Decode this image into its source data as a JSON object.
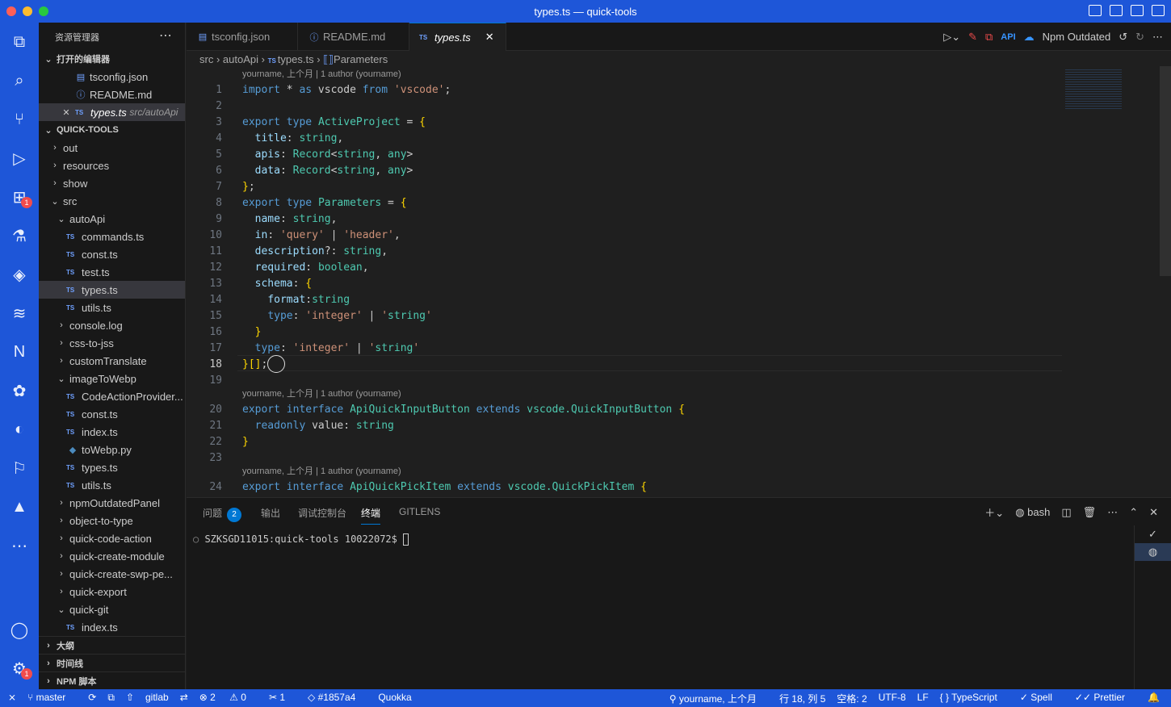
{
  "window": {
    "title": "types.ts — quick-tools"
  },
  "explorer": {
    "title": "资源管理器",
    "open_editors_label": "打开的编辑器",
    "open_editors": [
      {
        "name": "tsconfig.json"
      },
      {
        "name": "README.md"
      },
      {
        "name": "types.ts",
        "path": "src/autoApi"
      }
    ],
    "project_label": "QUICK-TOOLS",
    "tree": [
      {
        "name": "out",
        "kind": "folder",
        "depth": 1,
        "open": false
      },
      {
        "name": "resources",
        "kind": "folder",
        "depth": 1,
        "open": false
      },
      {
        "name": "show",
        "kind": "folder",
        "depth": 1,
        "open": false
      },
      {
        "name": "src",
        "kind": "folder",
        "depth": 1,
        "open": true
      },
      {
        "name": "autoApi",
        "kind": "folder",
        "depth": 2,
        "open": true
      },
      {
        "name": "commands.ts",
        "kind": "ts",
        "depth": 3
      },
      {
        "name": "const.ts",
        "kind": "ts",
        "depth": 3
      },
      {
        "name": "test.ts",
        "kind": "ts",
        "depth": 3
      },
      {
        "name": "types.ts",
        "kind": "ts",
        "depth": 3,
        "selected": true
      },
      {
        "name": "utils.ts",
        "kind": "ts",
        "depth": 3
      },
      {
        "name": "console.log",
        "kind": "folder",
        "depth": 2,
        "open": false
      },
      {
        "name": "css-to-jss",
        "kind": "folder",
        "depth": 2,
        "open": false
      },
      {
        "name": "customTranslate",
        "kind": "folder",
        "depth": 2,
        "open": false
      },
      {
        "name": "imageToWebp",
        "kind": "folder",
        "depth": 2,
        "open": true
      },
      {
        "name": "CodeActionProvider...",
        "kind": "ts",
        "depth": 3
      },
      {
        "name": "const.ts",
        "kind": "ts",
        "depth": 3
      },
      {
        "name": "index.ts",
        "kind": "ts",
        "depth": 3
      },
      {
        "name": "toWebp.py",
        "kind": "py",
        "depth": 3
      },
      {
        "name": "types.ts",
        "kind": "ts",
        "depth": 3
      },
      {
        "name": "utils.ts",
        "kind": "ts",
        "depth": 3
      },
      {
        "name": "npmOutdatedPanel",
        "kind": "folder",
        "depth": 2,
        "open": false
      },
      {
        "name": "object-to-type",
        "kind": "folder",
        "depth": 2,
        "open": false
      },
      {
        "name": "quick-code-action",
        "kind": "folder",
        "depth": 2,
        "open": false
      },
      {
        "name": "quick-create-module",
        "kind": "folder",
        "depth": 2,
        "open": false
      },
      {
        "name": "quick-create-swp-pe...",
        "kind": "folder",
        "depth": 2,
        "open": false
      },
      {
        "name": "quick-export",
        "kind": "folder",
        "depth": 2,
        "open": false
      },
      {
        "name": "quick-git",
        "kind": "folder",
        "depth": 2,
        "open": true
      },
      {
        "name": "index.ts",
        "kind": "ts",
        "depth": 3
      }
    ],
    "bottom_sections": [
      "大纲",
      "时间线",
      "NPM 脚本"
    ]
  },
  "tabs": [
    {
      "label": "tsconfig.json"
    },
    {
      "label": "README.md"
    },
    {
      "label": "types.ts",
      "active": true
    }
  ],
  "editor_actions": {
    "npm_label": "Npm Outdated"
  },
  "breadcrumb": [
    "src",
    "autoApi",
    "types.ts",
    "Parameters"
  ],
  "ts_tag": "TS",
  "blame": "yourname, 上个月 | 1 author (yourname)",
  "code": [
    "import * as vscode from 'vscode';",
    "",
    "export type ActiveProject = {",
    "  title: string,",
    "  apis: Record<string, any>",
    "  data: Record<string, any>",
    "};",
    "export type Parameters = {",
    "  name: string,",
    "  in: 'query' | 'header',",
    "  description?: string,",
    "  required: boolean,",
    "  schema: {",
    "    format:string",
    "    type: 'integer' | 'string'",
    "  }",
    "  type: 'integer' | 'string'",
    "}[];",
    "",
    "export interface ApiQuickInputButton extends vscode.QuickInputButton {",
    "  readonly value: string",
    "}",
    "",
    "export interface ApiQuickPickItem extends vscode.QuickPickItem {"
  ],
  "line_numbers": [
    "1",
    "2",
    "3",
    "4",
    "5",
    "6",
    "7",
    "8",
    "9",
    "10",
    "11",
    "12",
    "13",
    "14",
    "15",
    "16",
    "17",
    "18",
    "19",
    "20",
    "21",
    "22",
    "23",
    "24"
  ],
  "panel": {
    "tabs": [
      "问题",
      "输出",
      "调试控制台",
      "终端",
      "GITLENS"
    ],
    "problems_count": "2",
    "active_tab": "终端",
    "shell": "bash",
    "prompt": "SZKSGD11015:quick-tools 10022072$ "
  },
  "status": {
    "branch": "master",
    "remote": "gitlab",
    "errors": "2",
    "warnings": "0",
    "ports": "1",
    "commit": "#1857a4",
    "quokka": "Quokka",
    "blame": "yourname, 上个月",
    "position": "行 18, 列 5",
    "spaces": "空格: 2",
    "encoding": "UTF-8",
    "eol": "LF",
    "language": "TypeScript",
    "spell": "Spell",
    "prettier": "Prettier"
  },
  "colors": {
    "accent": "#1e56d8",
    "editor_bg": "#1f1f1f",
    "sidebar_bg": "#181818"
  }
}
